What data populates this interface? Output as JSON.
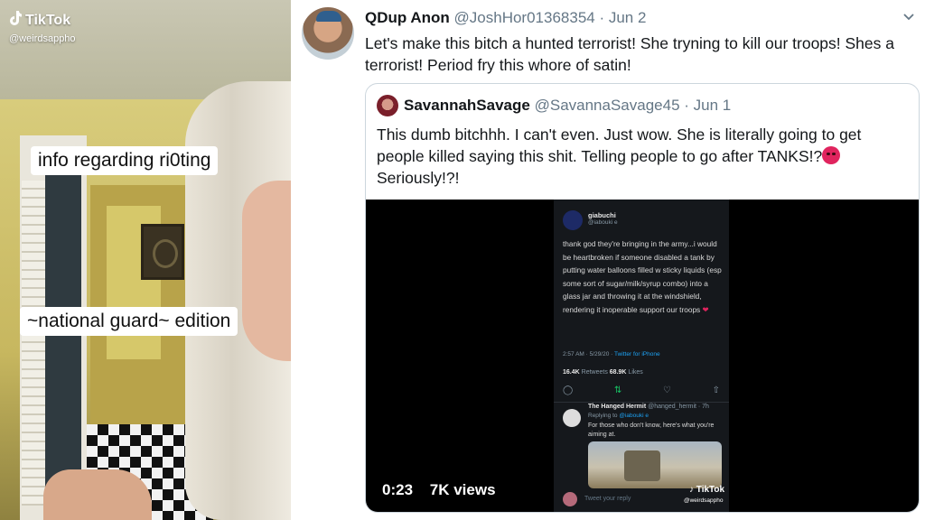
{
  "tiktok": {
    "logo_text": "TikTok",
    "handle": "@weirdsappho",
    "caption_1": "info regarding ri0ting",
    "caption_2": "~national guard~ edition",
    "icon": "tiktok-note-icon"
  },
  "tweet": {
    "author_name": "QDup Anon",
    "author_handle": "@JoshHor01368354",
    "date": "· Jun 2",
    "text": "Let's make this bitch a hunted terrorist! She tryning to kill our troops! Shes a terrorist! Period fry this whore of satin!",
    "menu_icon": "chevron-down-icon",
    "quoted": {
      "author_name": "SavannahSavage",
      "author_handle": "@SavannaSavage45",
      "date": "· Jun 1",
      "text_1": "This dumb bitchhh. I can't even. Just wow. She is literally going to get people killed saying this shit. Telling people to go after TANKS!?",
      "text_2": "Seriously!?!",
      "emoji": "angry-face-icon",
      "video": {
        "duration": "0:23",
        "views": "7K views",
        "inner_tweet": {
          "name": "giabuchi",
          "handle": "@iabouki e",
          "body": "thank god they're bringing in the army...i would be heartbroken if someone disabled a tank by putting water balloons filled w sticky liquids (esp some sort of sugar/milk/syrup combo) into a glass jar and throwing it at the windshield, rendering it inoperable support our troops",
          "time": "2:57 AM · 5/29/20 ·",
          "source": "Twitter for iPhone",
          "retweets": "16.4K",
          "retweets_label": "Retweets",
          "likes": "68.9K",
          "likes_label": "Likes",
          "reply_name": "The Hanged Hermit",
          "reply_handle": "@hanged_hermit · 7h",
          "replying_to_label": "Replying to",
          "replying_to": "@iabouki e",
          "reply_text": "For those who don't know, here's what you're aiming at.",
          "compose_placeholder": "Tweet your reply"
        },
        "watermark": "TikTok",
        "watermark_handle": "@weirdsappho"
      }
    }
  },
  "colors": {
    "text": "#14171a",
    "muted": "#657786",
    "border": "#ccd6dd",
    "twitter_blue": "#1da1f2",
    "retweet_green": "#17bf63",
    "like_red": "#e0245e"
  }
}
